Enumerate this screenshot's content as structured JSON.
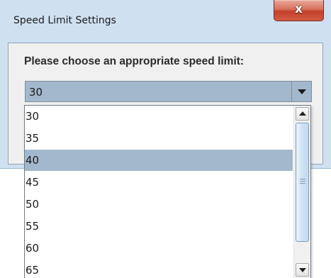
{
  "window": {
    "title": "Speed Limit Settings",
    "close_glyph": "x"
  },
  "dialog": {
    "prompt": "Please choose an appropriate speed limit:"
  },
  "combo": {
    "selected_value": "30"
  },
  "dropdown": {
    "options": [
      "30",
      "35",
      "40",
      "45",
      "50",
      "55",
      "60",
      "65"
    ],
    "highlighted_option": "40"
  },
  "colors": {
    "window_frame": "#cfe0f1",
    "selection": "#a3b8cc",
    "close_button": "#c4412b"
  }
}
